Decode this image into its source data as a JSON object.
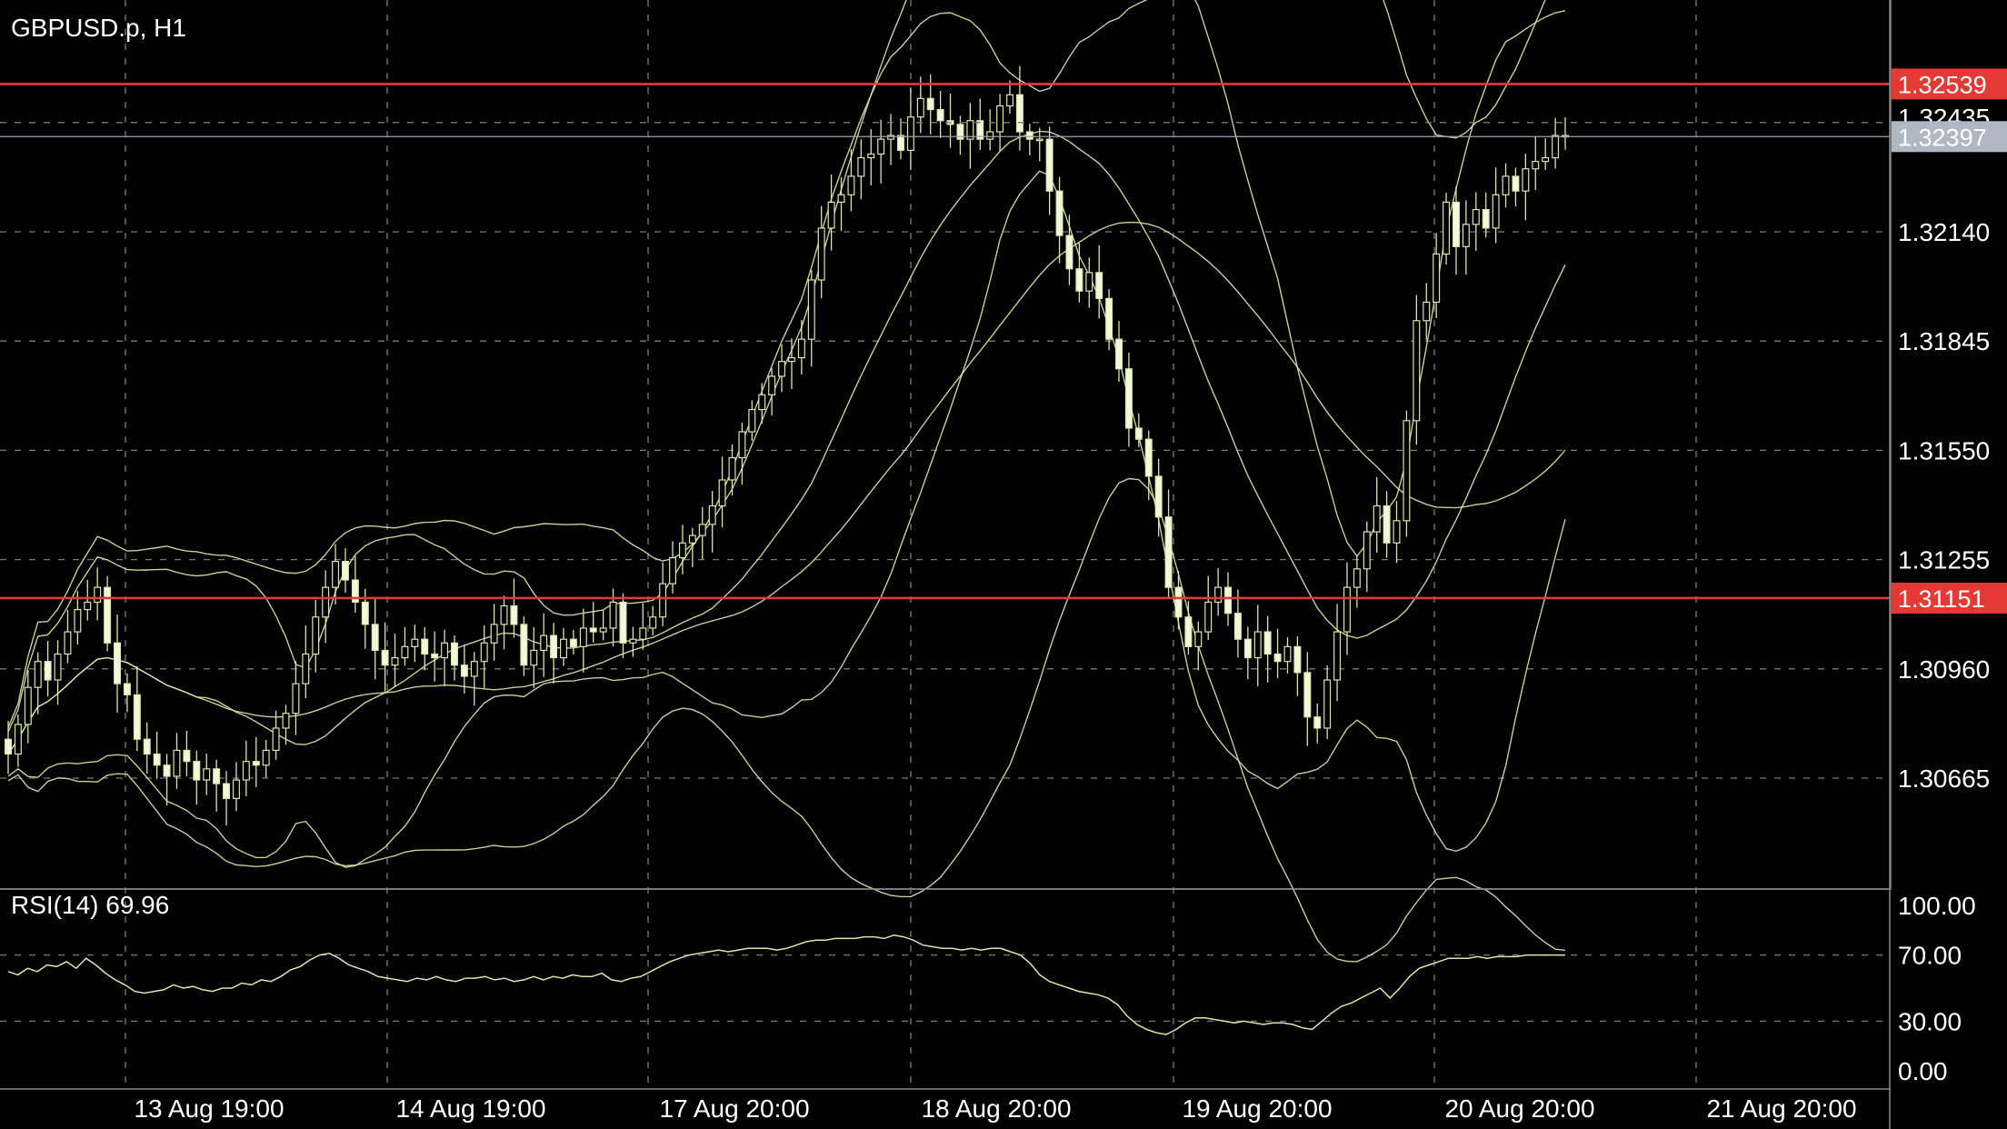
{
  "chart_data": [
    {
      "type": "candlestick",
      "title": "GBPUSD.p, H1",
      "y_ticks": [
        "1.32140",
        "1.31845",
        "1.31550",
        "1.31255",
        "1.30960",
        "1.30665"
      ],
      "ylim": [
        1.3038,
        1.3275
      ],
      "x_ticks": [
        "13 Aug 19:00",
        "14 Aug 19:00",
        "17 Aug 20:00",
        "18 Aug 20:00",
        "19 Aug 20:00",
        "20 Aug 20:00",
        "21 Aug 20:00"
      ],
      "price_levels": [
        {
          "label": "1.32539",
          "value": 1.32539,
          "color": "#e53935",
          "kind": "horizontal-line"
        },
        {
          "label": "1.32435",
          "value": 1.32435,
          "color": "#ffffff",
          "kind": "dashed-level"
        },
        {
          "label": "1.32397",
          "value": 1.32397,
          "color": "#b0b8c4",
          "kind": "bid-line"
        },
        {
          "label": "1.31151",
          "value": 1.31151,
          "color": "#e53935",
          "kind": "horizontal-line"
        }
      ],
      "candle_colors": {
        "bull": "#000000",
        "bear": "#f3f8dc",
        "outline": "#d7e8a8"
      },
      "indicators": [
        "Bollinger Bands",
        "Bollinger Bands"
      ],
      "close": [
        1.3073,
        1.3081,
        1.3091,
        1.3098,
        1.3093,
        1.31,
        1.3106,
        1.3112,
        1.3114,
        1.3118,
        1.3103,
        1.3092,
        1.3089,
        1.3077,
        1.3073,
        1.307,
        1.3067,
        1.3074,
        1.3071,
        1.3066,
        1.3069,
        1.3065,
        1.3061,
        1.3066,
        1.3071,
        1.307,
        1.3074,
        1.308,
        1.3084,
        1.3092,
        1.31,
        1.311,
        1.3118,
        1.3125,
        1.312,
        1.3114,
        1.3108,
        1.3101,
        1.3097,
        1.3099,
        1.3102,
        1.3104,
        1.31,
        1.3099,
        1.3103,
        1.3097,
        1.3094,
        1.3098,
        1.3103,
        1.3108,
        1.3113,
        1.3108,
        1.3097,
        1.3101,
        1.3105,
        1.3099,
        1.3104,
        1.3102,
        1.3107,
        1.3106,
        1.3107,
        1.3114,
        1.3103,
        1.3104,
        1.3107,
        1.311,
        1.3119,
        1.3126,
        1.313,
        1.3132,
        1.3135,
        1.314,
        1.3147,
        1.3153,
        1.316,
        1.3166,
        1.317,
        1.3175,
        1.3179,
        1.318,
        1.3185,
        1.3201,
        1.3215,
        1.3222,
        1.3224,
        1.3229,
        1.3234,
        1.3235,
        1.3239,
        1.324,
        1.3236,
        1.3245,
        1.325,
        1.3247,
        1.3244,
        1.3243,
        1.3239,
        1.3244,
        1.3239,
        1.3241,
        1.3248,
        1.3251,
        1.3241,
        1.3239,
        1.3239,
        1.3225,
        1.3213,
        1.3204,
        1.3198,
        1.3203,
        1.3196,
        1.3185,
        1.3177,
        1.3161,
        1.3158,
        1.3148,
        1.3137,
        1.3118,
        1.311,
        1.3102,
        1.3106,
        1.3114,
        1.3118,
        1.3111,
        1.3104,
        1.3099,
        1.3106,
        1.31,
        1.3098,
        1.3102,
        1.3095,
        1.3083,
        1.308,
        1.3093,
        1.3106,
        1.3118,
        1.3123,
        1.3133,
        1.314,
        1.313,
        1.3136,
        1.3163,
        1.319,
        1.3195,
        1.3208,
        1.3222,
        1.321,
        1.3216,
        1.322,
        1.3215,
        1.3224,
        1.3229,
        1.3225,
        1.3231,
        1.3233,
        1.3234,
        1.324,
        1.324
      ]
    },
    {
      "type": "line",
      "title": "RSI(14) 69.96",
      "y_ticks": [
        "100.00",
        "70.00",
        "30.00",
        "0.00"
      ],
      "ylim": [
        0,
        100
      ],
      "values": [
        60,
        58,
        62,
        60,
        64,
        63,
        66,
        62,
        68,
        64,
        59,
        55,
        52,
        48,
        47,
        48,
        49,
        52,
        50,
        51,
        49,
        48,
        50,
        50,
        53,
        52,
        55,
        54,
        57,
        61,
        63,
        67,
        70,
        71,
        68,
        64,
        62,
        60,
        57,
        56,
        55,
        54,
        56,
        55,
        57,
        55,
        54,
        56,
        56,
        57,
        55,
        56,
        54,
        55,
        57,
        55,
        57,
        56,
        58,
        57,
        57,
        59,
        55,
        54,
        56,
        57,
        60,
        63,
        66,
        68,
        70,
        71,
        72,
        73,
        72,
        73,
        74,
        74,
        74,
        73,
        74,
        76,
        78,
        79,
        79,
        80,
        80,
        80,
        81,
        81,
        80,
        82,
        81,
        79,
        76,
        75,
        74,
        74,
        73,
        74,
        73,
        74,
        74,
        72,
        70,
        65,
        58,
        54,
        52,
        50,
        48,
        47,
        46,
        44,
        40,
        33,
        28,
        25,
        23,
        22,
        25,
        29,
        32,
        32,
        31,
        30,
        29,
        30,
        29,
        28,
        29,
        29,
        28,
        26,
        25,
        30,
        35,
        39,
        41,
        44,
        47,
        50,
        44,
        50,
        57,
        62,
        64,
        66,
        68,
        68,
        68,
        69,
        68,
        69,
        69,
        69,
        70,
        70,
        70,
        70,
        70
      ]
    }
  ]
}
